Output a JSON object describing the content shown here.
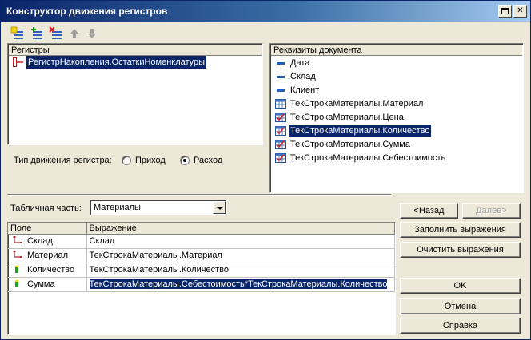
{
  "window": {
    "title": "Конструктор движения регистров"
  },
  "toolbar": {
    "icons": [
      "add-icon",
      "add-multiple-icon",
      "delete-icon",
      "move-up-icon",
      "move-down-icon"
    ]
  },
  "registers": {
    "header": "Регистры",
    "items": [
      {
        "label": "РегистрНакопления.ОстаткиНоменклатуры",
        "selected": true
      }
    ]
  },
  "movement_type": {
    "label": "Тип движения регистра:",
    "options": [
      {
        "label": "Приход",
        "checked": false
      },
      {
        "label": "Расход",
        "checked": true
      }
    ]
  },
  "requisites": {
    "header": "Реквизиты документа",
    "items": [
      {
        "label": "Дата",
        "icon": "field-icon"
      },
      {
        "label": "Склад",
        "icon": "field-icon"
      },
      {
        "label": "Клиент",
        "icon": "field-icon"
      },
      {
        "label": "ТекСтрокаМатериалы.Материал",
        "icon": "table-field-icon"
      },
      {
        "label": "ТекСтрокаМатериалы.Цена",
        "icon": "table-field-check-icon"
      },
      {
        "label": "ТекСтрокаМатериалы.Количество",
        "icon": "table-field-check-icon",
        "selected": true
      },
      {
        "label": "ТекСтрокаМатериалы.Сумма",
        "icon": "table-field-check-icon"
      },
      {
        "label": "ТекСтрокаМатериалы.Себестоимость",
        "icon": "table-field-check-icon"
      }
    ]
  },
  "tabular_part": {
    "label": "Табличная часть:",
    "value": "Материалы"
  },
  "grid": {
    "columns": [
      "Поле",
      "Выражение"
    ],
    "rows": [
      {
        "field": "Склад",
        "expr": "Склад",
        "icon": "dimension-icon"
      },
      {
        "field": "Материал",
        "expr": "ТекСтрокаМатериалы.Материал",
        "icon": "dimension-icon"
      },
      {
        "field": "Количество",
        "expr": "ТекСтрокаМатериалы.Количество",
        "icon": "resource-icon"
      },
      {
        "field": "Сумма",
        "expr": "ТекСтрокаМатериалы.Себестоимость*ТекСтрокаМатериалы.Количество",
        "icon": "resource-icon",
        "selected": true
      }
    ]
  },
  "buttons": {
    "back": "<Назад",
    "next": "Далее>",
    "fill": "Заполнить выражения",
    "clear": "Очистить выражения",
    "ok": "OK",
    "cancel": "Отмена",
    "help": "Справка"
  },
  "colors": {
    "selection": "#0a246a",
    "face": "#ece9d8",
    "title_start": "#0a246a",
    "title_end": "#a6caf0"
  }
}
